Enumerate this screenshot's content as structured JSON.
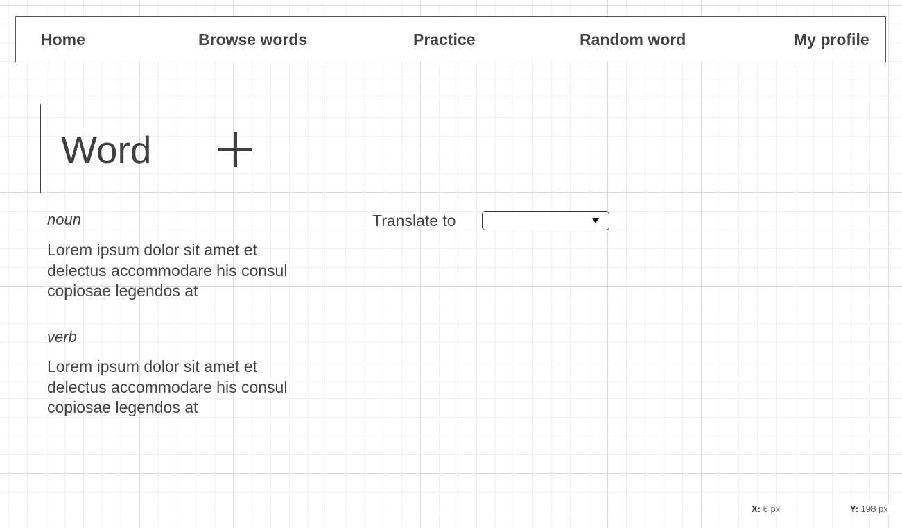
{
  "nav": {
    "items": [
      {
        "label": "Home"
      },
      {
        "label": "Browse words"
      },
      {
        "label": "Practice"
      },
      {
        "label": "Random word"
      },
      {
        "label": "My profile"
      }
    ]
  },
  "word": {
    "title": "Word",
    "add_icon": "plus-icon"
  },
  "senses": [
    {
      "pos": "noun",
      "definition": "Lorem ipsum dolor sit amet et delectus accommodare his consul copiosae legendos at"
    },
    {
      "pos": "verb",
      "definition": "Lorem ipsum dolor sit amet et delectus accommodare his consul copiosae legendos at"
    }
  ],
  "translate": {
    "label": "Translate to",
    "selected": "",
    "caret_icon": "caret-down-icon"
  },
  "status": {
    "x_label": "X:",
    "x_value": "6 px",
    "y_label": "Y:",
    "y_value": "198 px"
  }
}
